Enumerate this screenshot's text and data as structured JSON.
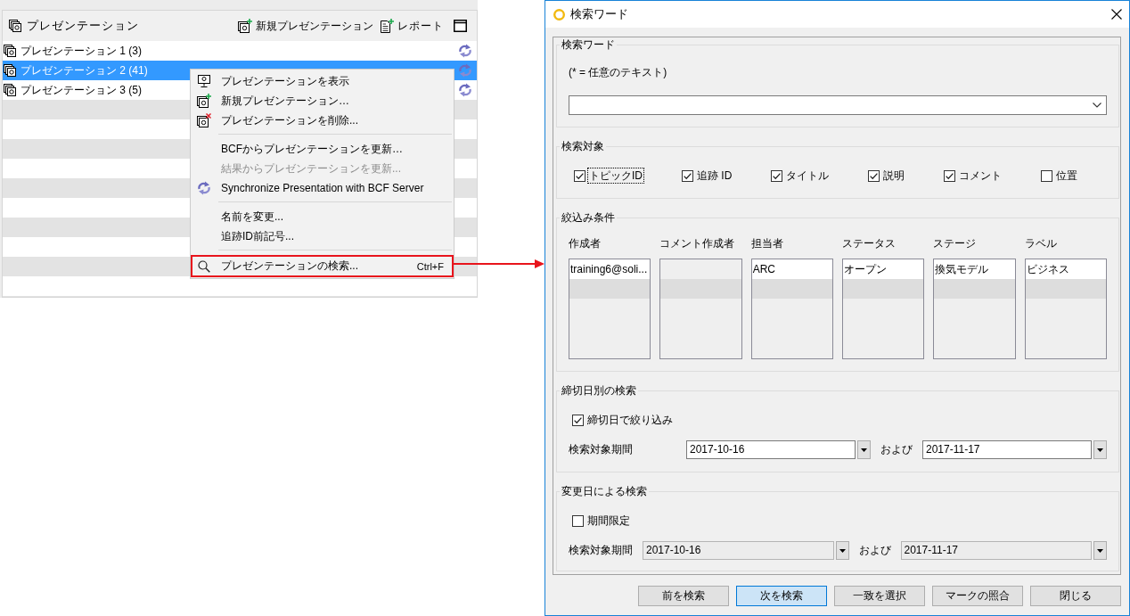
{
  "presentations_panel": {
    "title": "プレゼンテーション",
    "toolbar": [
      {
        "label": "新規プレゼンテーション"
      },
      {
        "label": "レポート"
      }
    ],
    "items": [
      {
        "label": "プレゼンテーション 1 (3)",
        "selected": false
      },
      {
        "label": "プレゼンテーション 2 (41)",
        "selected": true
      },
      {
        "label": "プレゼンテーション 3 (5)",
        "selected": false
      }
    ]
  },
  "context_menu": {
    "groups": [
      [
        {
          "label": "プレゼンテーションを表示",
          "disabled": false,
          "highlighted": false
        },
        {
          "label": "新規プレゼンテーション…",
          "disabled": false,
          "highlighted": false
        },
        {
          "label": "プレゼンテーションを削除...",
          "disabled": false,
          "highlighted": false
        }
      ],
      [
        {
          "label": "BCFからプレゼンテーションを更新…",
          "disabled": false,
          "highlighted": false
        },
        {
          "label": "結果からプレゼンテーションを更新...",
          "disabled": true,
          "highlighted": false
        },
        {
          "label": "Synchronize Presentation with BCF Server",
          "disabled": false,
          "highlighted": false
        }
      ],
      [
        {
          "label": "名前を変更...",
          "disabled": false,
          "highlighted": false
        },
        {
          "label": "追跡ID前記号...",
          "disabled": false,
          "highlighted": false
        }
      ],
      [
        {
          "label": "プレゼンテーションの検索...",
          "shortcut": "Ctrl+F",
          "disabled": false,
          "highlighted": true
        }
      ]
    ]
  },
  "dialog": {
    "title": "検索ワード",
    "search_word": {
      "legend": "検索ワード",
      "hint": "(* = 任意のテキスト)"
    },
    "search_in": {
      "legend": "検索対象",
      "options": [
        {
          "label": "トピックID",
          "checked": true,
          "focused": true
        },
        {
          "label": "追跡 ID",
          "checked": true,
          "focused": false
        },
        {
          "label": "タイトル",
          "checked": true,
          "focused": false
        },
        {
          "label": "説明",
          "checked": true,
          "focused": false
        },
        {
          "label": "コメント",
          "checked": true,
          "focused": false
        },
        {
          "label": "位置",
          "checked": false,
          "focused": false
        }
      ]
    },
    "filters": {
      "legend": "絞込み条件",
      "columns": [
        {
          "label": "作成者",
          "items": [
            "training6@soli..."
          ]
        },
        {
          "label": "コメント作成者"
        },
        {
          "label": "担当者",
          "items": [
            "ARC"
          ]
        },
        {
          "label": "ステータス",
          "items": [
            "オープン"
          ]
        },
        {
          "label": "ステージ",
          "items": [
            "換気モデル"
          ]
        },
        {
          "label": "ラベル",
          "items": [
            "ビジネス"
          ]
        }
      ]
    },
    "deadline_search": {
      "legend": "締切日別の検索",
      "filter": {
        "label": "締切日で絞り込み",
        "checked": true
      },
      "range": {
        "label": "検索対象期間",
        "from": "2017-10-16",
        "conjunction": "および",
        "to": "2017-11-17",
        "disabled": false
      }
    },
    "modified_search": {
      "legend": "変更日による検索",
      "filter": {
        "label": "期間限定",
        "checked": false
      },
      "range": {
        "label": "検索対象期間",
        "from": "2017-10-16",
        "conjunction": "および",
        "to": "2017-11-17",
        "disabled": true
      }
    },
    "buttons": [
      {
        "label": "前を検索",
        "default": false
      },
      {
        "label": "次を検索",
        "default": true
      },
      {
        "label": "一致を選択",
        "default": false
      },
      {
        "label": "マークの照合",
        "default": false
      },
      {
        "label": "閉じる",
        "default": false
      }
    ]
  }
}
